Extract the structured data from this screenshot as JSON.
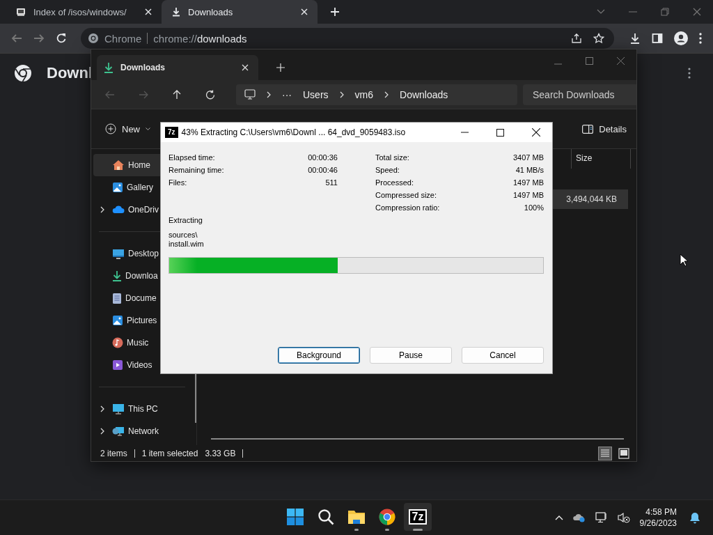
{
  "chrome": {
    "tabs": [
      {
        "title": "Index of /isos/windows/",
        "kind": "page",
        "selected": false
      },
      {
        "title": "Downloads",
        "kind": "download",
        "selected": true
      }
    ],
    "omnibox": {
      "site_label": "Chrome",
      "url_prefix": "chrome://",
      "url_rest": "downloads"
    },
    "page": {
      "title": "Downl"
    }
  },
  "explorer": {
    "tab": {
      "title": "Downloads"
    },
    "breadcrumb": {
      "overflow": "···",
      "parts": [
        "Users",
        "vm6",
        "Downloads"
      ]
    },
    "search": {
      "placeholder": "Search Downloads"
    },
    "toolbar": {
      "new_label": "New",
      "details_label": "Details"
    },
    "columns": [
      "Size"
    ],
    "rows": [
      {
        "size": "3,494,044 KB",
        "selected": true
      }
    ],
    "sidebar": [
      [
        {
          "label": "Home",
          "kind": "home",
          "expandable": false,
          "selected": true
        },
        {
          "label": "Gallery",
          "kind": "gallery",
          "expandable": false,
          "selected": false
        },
        {
          "label": "OneDriv",
          "kind": "cloud",
          "expandable": true,
          "selected": false
        }
      ],
      [
        {
          "label": "Desktop",
          "kind": "desktop",
          "expandable": false,
          "selected": false
        },
        {
          "label": "Downloa",
          "kind": "download",
          "expandable": false,
          "selected": false
        },
        {
          "label": "Docume",
          "kind": "documents",
          "expandable": false,
          "selected": false
        },
        {
          "label": "Pictures",
          "kind": "pictures",
          "expandable": false,
          "selected": false
        },
        {
          "label": "Music",
          "kind": "music",
          "expandable": false,
          "selected": false
        },
        {
          "label": "Videos",
          "kind": "videos",
          "expandable": false,
          "selected": false
        }
      ],
      [
        {
          "label": "This PC",
          "kind": "pc",
          "expandable": true,
          "selected": false
        },
        {
          "label": "Network",
          "kind": "network",
          "expandable": true,
          "selected": false
        }
      ]
    ],
    "status": {
      "count": "2 items",
      "selection": "1 item selected",
      "size": "3.33 GB"
    }
  },
  "dialog": {
    "logo_text": "7z",
    "title": "43% Extracting C:\\Users\\vm6\\Downl ... 64_dvd_9059483.iso",
    "stats_left": [
      {
        "label": "Elapsed time:",
        "value": "00:00:36"
      },
      {
        "label": "Remaining time:",
        "value": "00:00:46"
      },
      {
        "label": "Files:",
        "value": "511"
      }
    ],
    "stats_right": [
      {
        "label": "Total size:",
        "value": "3407 MB"
      },
      {
        "label": "Speed:",
        "value": "41 MB/s"
      },
      {
        "label": "Processed:",
        "value": "1497 MB"
      },
      {
        "label": "Compressed size:",
        "value": "1497 MB"
      },
      {
        "label": "Compression ratio:",
        "value": "100%"
      }
    ],
    "operation": "Extracting",
    "path_lines": [
      "sources\\",
      "install.wim"
    ],
    "progress": {
      "level": 0.45
    },
    "buttons": [
      {
        "label": "Background",
        "default": true
      },
      {
        "label": "Pause",
        "default": false
      },
      {
        "label": "Cancel",
        "default": false
      }
    ]
  },
  "taskbar": {
    "apps": [
      {
        "kind": "start",
        "running": false,
        "active": false
      },
      {
        "kind": "search",
        "running": false,
        "active": false
      },
      {
        "kind": "explorer",
        "running": true,
        "active": false
      },
      {
        "kind": "chrome",
        "running": true,
        "active": false
      },
      {
        "kind": "sevenzip",
        "label": "7z",
        "running": true,
        "active": true
      }
    ],
    "clock": {
      "time": "4:58 PM",
      "date": "9/26/2023"
    }
  }
}
